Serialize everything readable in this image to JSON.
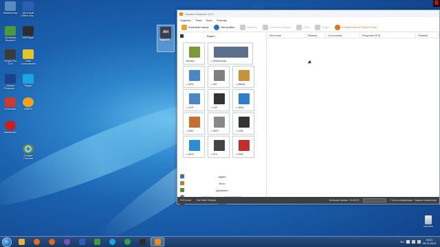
{
  "desktop": {
    "icons": [
      {
        "label": "Компьютер",
        "color": "#5b8bc4"
      },
      {
        "label": "Microsoft Office Wo...",
        "color": "#2b5fb3"
      },
      {
        "label": "Camtasia Studio 8",
        "color": "#4a9a3a"
      },
      {
        "label": "KMPlayer",
        "color": "#2d2d2d"
      },
      {
        "label": "Vegas Pro 13.0",
        "color": "#3b3b3b"
      },
      {
        "label": "Total Commander",
        "color": "#e6c32b"
      },
      {
        "label": "Adobe Photosh...",
        "color": "#1c3f8e"
      },
      {
        "label": "Skype",
        "color": "#18a7e0"
      },
      {
        "label": "CCleaner",
        "color": "#cc3a2c"
      },
      {
        "label": "AIMP3",
        "color": "#f2a21b"
      },
      {
        "label": "Bandicam",
        "color": "#c91f1f"
      },
      {
        "label": "Google Chrome",
        "color": "#3a9e48"
      }
    ],
    "file": {
      "label": "Водяной ...",
      "badge": "AVI"
    },
    "recycle_label": "Корзина",
    "rec_mark": "R"
  },
  "window": {
    "title": "Формат-Фабрика 3.9.5",
    "menu": [
      "Задание",
      "Тема",
      "Язык",
      "Помощь"
    ],
    "toolbar": [
      {
        "label": "Конечная папка",
        "color": "#e6a22c",
        "disabled": false
      },
      {
        "label": "Настройки",
        "color": "#2b6fc7",
        "disabled": false
      },
      {
        "label": "Удалить",
        "color": "#cccccc",
        "disabled": true
      },
      {
        "label": "Очистить список",
        "color": "#cccccc",
        "disabled": true
      },
      {
        "label": "Стоп",
        "color": "#cccccc",
        "disabled": true
      },
      {
        "label": "Старт",
        "color": "#cccccc",
        "disabled": true
      },
      {
        "label": "Format Factory Picture Tools",
        "color": "#e07418",
        "disabled": false,
        "orange": true
      }
    ],
    "video_section": "Видео",
    "tiles": [
      {
        "label": "Экспорт",
        "color": "#7a9a3a"
      },
      {
        "label": "-> Мобильные",
        "color": "#5b6f8a"
      },
      {
        "label": "-> MP4",
        "color": "#4a86c8"
      },
      {
        "label": "-> AVI",
        "color": "#7f7f7f"
      },
      {
        "label": "-> WebM",
        "color": "#c8933a"
      },
      {
        "label": "-> 3GP",
        "color": "#4a86c8"
      },
      {
        "label": "-> GIF",
        "color": "#333333"
      },
      {
        "label": "-> WMV",
        "color": "#2f7fc8"
      },
      {
        "label": "-> MKV",
        "color": "#c86f2f"
      },
      {
        "label": "-> MPG",
        "color": "#888888"
      },
      {
        "label": "-> VOB",
        "color": "#333333"
      },
      {
        "label": "-> MOV",
        "color": "#2a8fd2"
      },
      {
        "label": "-> FLV",
        "color": "#444444"
      },
      {
        "label": "-> SWF",
        "color": "#c0302a"
      }
    ],
    "categories": [
      {
        "label": "Аудио",
        "color": "#3a6fb0"
      },
      {
        "label": "Фото",
        "color": "#b0823a"
      },
      {
        "label": "Документ",
        "color": "#5a8a3a"
      },
      {
        "label": "ROM Устройство\\DVD\\CD\\ISO",
        "color": "#777777"
      },
      {
        "label": "Utilities",
        "color": "#444444"
      }
    ],
    "columns": [
      "Источник",
      "Размер",
      "Состояние",
      "Результат [F2]",
      "Размер"
    ],
    "status": {
      "folder": "D:\\Format",
      "task_label": "Use Multi-Threads",
      "elapsed_label": "Истекшее время : 00:00:00",
      "after_label": "После конвертации : Закрыть компьютер"
    }
  },
  "taskbar": {
    "apps": [
      {
        "name": "explorer-icon",
        "color": "#e3b43a"
      },
      {
        "name": "media-player-icon",
        "color": "#e76b1f"
      },
      {
        "name": "firefox-icon",
        "color": "#e2661d"
      },
      {
        "name": "viber-icon",
        "color": "#7a4fb8"
      },
      {
        "name": "word-icon",
        "color": "#2b5fb3"
      },
      {
        "name": "camtasia-icon",
        "color": "#3f9b3c"
      },
      {
        "name": "skype-icon",
        "color": "#18a7e0"
      },
      {
        "name": "chrome-icon",
        "color": "#3a9e48"
      },
      {
        "name": "kmplayer-icon",
        "color": "#2d2d2d"
      },
      {
        "name": "format-factory-icon",
        "color": "#e88c22"
      }
    ],
    "lang": "RU",
    "time": "20:21",
    "date": "06.12.2015"
  }
}
